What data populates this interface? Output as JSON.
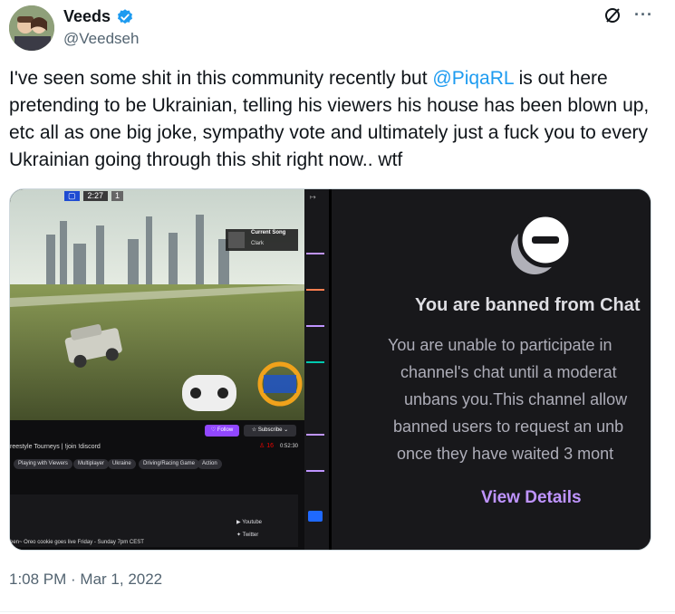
{
  "author": {
    "display_name": "Veeds",
    "handle": "@Veedseh",
    "verified": true,
    "avatar_icon": "avatar-photo"
  },
  "icons": {
    "grok": "grok-icon",
    "more": "more-options-icon"
  },
  "tweet": {
    "text_before": "I've seen some shit in this community recently but ",
    "mention": "@PiqaRL",
    "text_after": " is out here pretending to be Ukrainian, telling his viewers his house has been blown up, etc all as one big joke, sympathy vote and ultimately just a fuck you to every Ukrainian going through this shit right now.. wtf",
    "timestamp": "1:08 PM · Mar 1, 2022"
  },
  "media_left": {
    "hud_score": "2:27",
    "hud_count": "1",
    "current_song_title": "Current Song",
    "current_song_artist": "Clark",
    "stream_title": "reestyle Tourneys | !join !discord",
    "follow_label": "Follow",
    "subscribe_label": "Subscribe",
    "viewer_count": "16",
    "uptime": "0:52:30",
    "tags": [
      "Playing with Viewers",
      "Multiplayer",
      "Ukraine",
      "Driving/Racing Game",
      "Action"
    ],
    "links": [
      "Youtube",
      "Twitter"
    ],
    "footer_text": "een~ Oreo cookie goes live Friday - Sunday 7pm CEST"
  },
  "media_right": {
    "ban_title": "You are banned from Chat",
    "ban_lines": [
      "You are unable to participate in",
      "channel's chat until a moderat",
      "unbans you.This channel allow",
      "banned users to request an unb",
      "once they have waited 3 mont"
    ],
    "view_details": "View Details"
  },
  "colors": {
    "accent": "#1d9bf0",
    "twitch_purple": "#9147ff",
    "twitch_link": "#bf94ff"
  }
}
